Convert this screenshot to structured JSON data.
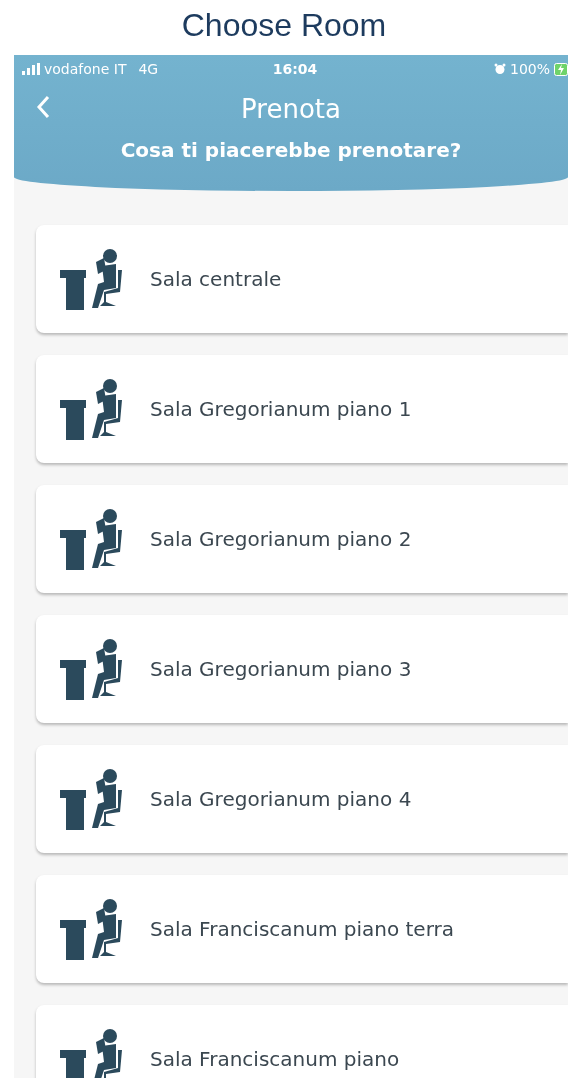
{
  "caption": "Choose Room",
  "status_bar": {
    "carrier": "vodafone IT",
    "network": "4G",
    "time": "16:04",
    "battery": "100%"
  },
  "header": {
    "title": "Prenota",
    "subtitle": "Cosa ti piacerebbe prenotare?"
  },
  "rooms": [
    {
      "name": "Sala centrale"
    },
    {
      "name": "Sala Gregorianum piano 1"
    },
    {
      "name": "Sala Gregorianum piano 2"
    },
    {
      "name": "Sala Gregorianum piano 3"
    },
    {
      "name": "Sala Gregorianum piano 4"
    },
    {
      "name": "Sala Franciscanum piano terra"
    },
    {
      "name": "Sala Franciscanum piano"
    }
  ]
}
